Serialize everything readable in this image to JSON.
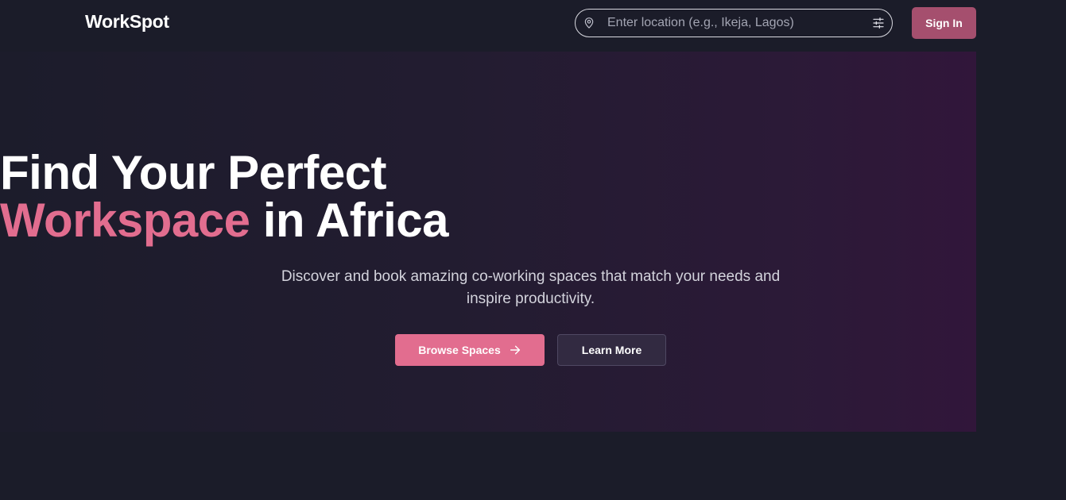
{
  "header": {
    "logo_text": "WorkSpot",
    "search": {
      "placeholder": "Enter location (e.g., Ikeja, Lagos)",
      "value": "",
      "leading_icon": "map-pin-icon",
      "trailing_icon": "filter-sliders-icon"
    },
    "sign_in_label": "Sign In"
  },
  "hero": {
    "headline_line1": "Find Your Perfect",
    "headline_accent": "Workspace",
    "headline_rest": " in Africa",
    "subtitle": "Discover and book amazing co-working spaces that match your needs and inspire productivity.",
    "primary_button": {
      "label": "Browse Spaces",
      "icon": "arrow-right-icon"
    },
    "secondary_button": {
      "label": "Learn More"
    }
  },
  "colors": {
    "page_background": "#1b1c29",
    "accent": "#e26d8f",
    "sign_in_button": "#a54f6e",
    "secondary_button": "#322a41",
    "hero_gradient_end": "#31163a",
    "subtitle_text": "#d3d3dc"
  }
}
